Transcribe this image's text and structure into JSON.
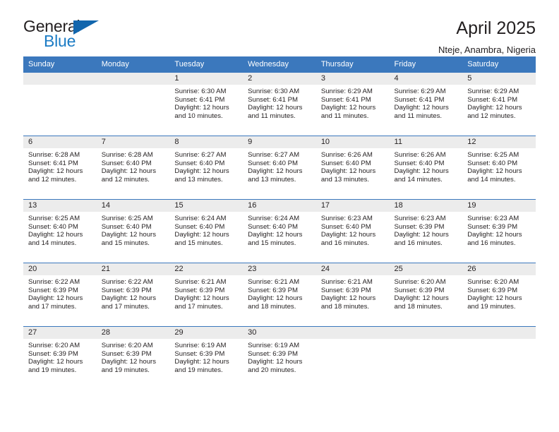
{
  "brand": {
    "word_one": "General",
    "word_two": "Blue",
    "triangle_icon": "triangle-icon",
    "accent_color": "#1b7bc4",
    "triangle_color": "#1266ad"
  },
  "header": {
    "title": "April 2025",
    "location": "Nteje, Anambra, Nigeria"
  },
  "calendar": {
    "header_color": "#3b78bd",
    "daynum_bg": "#ececec",
    "weekday_names": [
      "Sunday",
      "Monday",
      "Tuesday",
      "Wednesday",
      "Thursday",
      "Friday",
      "Saturday"
    ],
    "labels": {
      "sunrise": "Sunrise:",
      "sunset": "Sunset:",
      "daylight": "Daylight:"
    },
    "weeks": [
      [
        {
          "day": "",
          "sunrise": "",
          "sunset": "",
          "daylight_line1": "",
          "daylight_line2": ""
        },
        {
          "day": "",
          "sunrise": "",
          "sunset": "",
          "daylight_line1": "",
          "daylight_line2": ""
        },
        {
          "day": "1",
          "sunrise": "Sunrise: 6:30 AM",
          "sunset": "Sunset: 6:41 PM",
          "daylight_line1": "Daylight: 12 hours",
          "daylight_line2": "and 10 minutes."
        },
        {
          "day": "2",
          "sunrise": "Sunrise: 6:30 AM",
          "sunset": "Sunset: 6:41 PM",
          "daylight_line1": "Daylight: 12 hours",
          "daylight_line2": "and 11 minutes."
        },
        {
          "day": "3",
          "sunrise": "Sunrise: 6:29 AM",
          "sunset": "Sunset: 6:41 PM",
          "daylight_line1": "Daylight: 12 hours",
          "daylight_line2": "and 11 minutes."
        },
        {
          "day": "4",
          "sunrise": "Sunrise: 6:29 AM",
          "sunset": "Sunset: 6:41 PM",
          "daylight_line1": "Daylight: 12 hours",
          "daylight_line2": "and 11 minutes."
        },
        {
          "day": "5",
          "sunrise": "Sunrise: 6:29 AM",
          "sunset": "Sunset: 6:41 PM",
          "daylight_line1": "Daylight: 12 hours",
          "daylight_line2": "and 12 minutes."
        }
      ],
      [
        {
          "day": "6",
          "sunrise": "Sunrise: 6:28 AM",
          "sunset": "Sunset: 6:41 PM",
          "daylight_line1": "Daylight: 12 hours",
          "daylight_line2": "and 12 minutes."
        },
        {
          "day": "7",
          "sunrise": "Sunrise: 6:28 AM",
          "sunset": "Sunset: 6:40 PM",
          "daylight_line1": "Daylight: 12 hours",
          "daylight_line2": "and 12 minutes."
        },
        {
          "day": "8",
          "sunrise": "Sunrise: 6:27 AM",
          "sunset": "Sunset: 6:40 PM",
          "daylight_line1": "Daylight: 12 hours",
          "daylight_line2": "and 13 minutes."
        },
        {
          "day": "9",
          "sunrise": "Sunrise: 6:27 AM",
          "sunset": "Sunset: 6:40 PM",
          "daylight_line1": "Daylight: 12 hours",
          "daylight_line2": "and 13 minutes."
        },
        {
          "day": "10",
          "sunrise": "Sunrise: 6:26 AM",
          "sunset": "Sunset: 6:40 PM",
          "daylight_line1": "Daylight: 12 hours",
          "daylight_line2": "and 13 minutes."
        },
        {
          "day": "11",
          "sunrise": "Sunrise: 6:26 AM",
          "sunset": "Sunset: 6:40 PM",
          "daylight_line1": "Daylight: 12 hours",
          "daylight_line2": "and 14 minutes."
        },
        {
          "day": "12",
          "sunrise": "Sunrise: 6:25 AM",
          "sunset": "Sunset: 6:40 PM",
          "daylight_line1": "Daylight: 12 hours",
          "daylight_line2": "and 14 minutes."
        }
      ],
      [
        {
          "day": "13",
          "sunrise": "Sunrise: 6:25 AM",
          "sunset": "Sunset: 6:40 PM",
          "daylight_line1": "Daylight: 12 hours",
          "daylight_line2": "and 14 minutes."
        },
        {
          "day": "14",
          "sunrise": "Sunrise: 6:25 AM",
          "sunset": "Sunset: 6:40 PM",
          "daylight_line1": "Daylight: 12 hours",
          "daylight_line2": "and 15 minutes."
        },
        {
          "day": "15",
          "sunrise": "Sunrise: 6:24 AM",
          "sunset": "Sunset: 6:40 PM",
          "daylight_line1": "Daylight: 12 hours",
          "daylight_line2": "and 15 minutes."
        },
        {
          "day": "16",
          "sunrise": "Sunrise: 6:24 AM",
          "sunset": "Sunset: 6:40 PM",
          "daylight_line1": "Daylight: 12 hours",
          "daylight_line2": "and 15 minutes."
        },
        {
          "day": "17",
          "sunrise": "Sunrise: 6:23 AM",
          "sunset": "Sunset: 6:40 PM",
          "daylight_line1": "Daylight: 12 hours",
          "daylight_line2": "and 16 minutes."
        },
        {
          "day": "18",
          "sunrise": "Sunrise: 6:23 AM",
          "sunset": "Sunset: 6:39 PM",
          "daylight_line1": "Daylight: 12 hours",
          "daylight_line2": "and 16 minutes."
        },
        {
          "day": "19",
          "sunrise": "Sunrise: 6:23 AM",
          "sunset": "Sunset: 6:39 PM",
          "daylight_line1": "Daylight: 12 hours",
          "daylight_line2": "and 16 minutes."
        }
      ],
      [
        {
          "day": "20",
          "sunrise": "Sunrise: 6:22 AM",
          "sunset": "Sunset: 6:39 PM",
          "daylight_line1": "Daylight: 12 hours",
          "daylight_line2": "and 17 minutes."
        },
        {
          "day": "21",
          "sunrise": "Sunrise: 6:22 AM",
          "sunset": "Sunset: 6:39 PM",
          "daylight_line1": "Daylight: 12 hours",
          "daylight_line2": "and 17 minutes."
        },
        {
          "day": "22",
          "sunrise": "Sunrise: 6:21 AM",
          "sunset": "Sunset: 6:39 PM",
          "daylight_line1": "Daylight: 12 hours",
          "daylight_line2": "and 17 minutes."
        },
        {
          "day": "23",
          "sunrise": "Sunrise: 6:21 AM",
          "sunset": "Sunset: 6:39 PM",
          "daylight_line1": "Daylight: 12 hours",
          "daylight_line2": "and 18 minutes."
        },
        {
          "day": "24",
          "sunrise": "Sunrise: 6:21 AM",
          "sunset": "Sunset: 6:39 PM",
          "daylight_line1": "Daylight: 12 hours",
          "daylight_line2": "and 18 minutes."
        },
        {
          "day": "25",
          "sunrise": "Sunrise: 6:20 AM",
          "sunset": "Sunset: 6:39 PM",
          "daylight_line1": "Daylight: 12 hours",
          "daylight_line2": "and 18 minutes."
        },
        {
          "day": "26",
          "sunrise": "Sunrise: 6:20 AM",
          "sunset": "Sunset: 6:39 PM",
          "daylight_line1": "Daylight: 12 hours",
          "daylight_line2": "and 19 minutes."
        }
      ],
      [
        {
          "day": "27",
          "sunrise": "Sunrise: 6:20 AM",
          "sunset": "Sunset: 6:39 PM",
          "daylight_line1": "Daylight: 12 hours",
          "daylight_line2": "and 19 minutes."
        },
        {
          "day": "28",
          "sunrise": "Sunrise: 6:20 AM",
          "sunset": "Sunset: 6:39 PM",
          "daylight_line1": "Daylight: 12 hours",
          "daylight_line2": "and 19 minutes."
        },
        {
          "day": "29",
          "sunrise": "Sunrise: 6:19 AM",
          "sunset": "Sunset: 6:39 PM",
          "daylight_line1": "Daylight: 12 hours",
          "daylight_line2": "and 19 minutes."
        },
        {
          "day": "30",
          "sunrise": "Sunrise: 6:19 AM",
          "sunset": "Sunset: 6:39 PM",
          "daylight_line1": "Daylight: 12 hours",
          "daylight_line2": "and 20 minutes."
        },
        {
          "day": "",
          "sunrise": "",
          "sunset": "",
          "daylight_line1": "",
          "daylight_line2": ""
        },
        {
          "day": "",
          "sunrise": "",
          "sunset": "",
          "daylight_line1": "",
          "daylight_line2": ""
        },
        {
          "day": "",
          "sunrise": "",
          "sunset": "",
          "daylight_line1": "",
          "daylight_line2": ""
        }
      ]
    ]
  }
}
